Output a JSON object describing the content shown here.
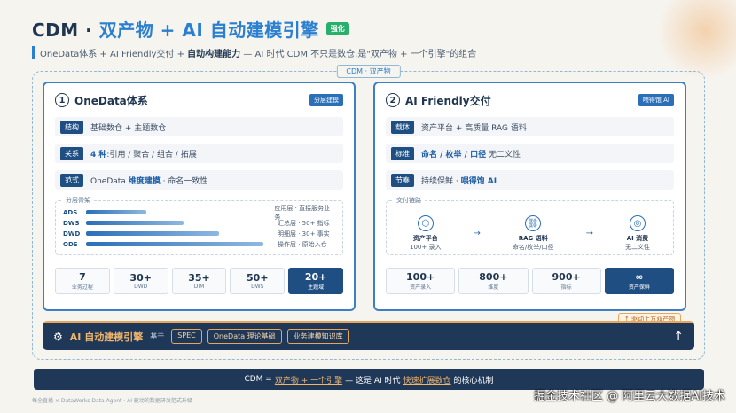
{
  "header": {
    "title_main": "CDM · ",
    "title_accent": "双产物 + AI 自动建模引擎",
    "badge": "强化",
    "subtitle_pre": "OneData体系 + AI Friendly交付 + ",
    "subtitle_bold": "自动构建能力",
    "subtitle_post": " — AI 时代 CDM 不只是数仓,是\"双产物 + 一个引擎\"的组合"
  },
  "frame_tag": "CDM · 双产物",
  "left_panel": {
    "num": "1",
    "title": "OneData体系",
    "tag": "分层建模",
    "rows": [
      {
        "label": "结构",
        "text": "基础数仓 + 主题数仓",
        "hi": "",
        "post": ""
      },
      {
        "label": "关系",
        "text": "",
        "hi": "4 种",
        "post": ":引用 / 聚合 / 组合 / 拓展"
      },
      {
        "label": "范式",
        "text": "OneData ",
        "hi": "维度建模",
        "post": " · 命名一致性"
      }
    ],
    "layers_title": "分层骨架",
    "layers": [
      {
        "code": "ADS",
        "fill": 0.35,
        "desc": "应用层 · 直接服务业务"
      },
      {
        "code": "DWS",
        "fill": 0.55,
        "desc": "汇总层 · 50+ 指标"
      },
      {
        "code": "DWD",
        "fill": 0.75,
        "desc": "明细层 · 30+ 事实"
      },
      {
        "code": "ODS",
        "fill": 1.0,
        "desc": "操作层 · 原始入仓"
      }
    ],
    "stats": [
      {
        "v": "7",
        "l": "业务过程"
      },
      {
        "v": "30+",
        "l": "DWD"
      },
      {
        "v": "35+",
        "l": "DIM"
      },
      {
        "v": "50+",
        "l": "DWS"
      },
      {
        "v": "20+",
        "l": "主题域"
      }
    ]
  },
  "right_panel": {
    "num": "2",
    "title": "AI Friendly交付",
    "tag": "喂得饱 AI",
    "rows": [
      {
        "label": "载体",
        "text": "资产平台 + 高质量 RAG 语料",
        "hi": "",
        "post": ""
      },
      {
        "label": "标准",
        "text": "",
        "hi": "命名 / 枚举 / 口径",
        "post": "  无二义性"
      },
      {
        "label": "节奏",
        "text": "持续保鲜 · ",
        "hi": "喂得饱 AI",
        "post": ""
      }
    ],
    "flow_title": "交付链路",
    "flow": [
      {
        "icon": "⬡",
        "name": "资产平台",
        "sub": "100+ 录入"
      },
      {
        "icon": "⛓",
        "name": "RAG 语料",
        "sub": "命名/枚举/口径"
      },
      {
        "icon": "◎",
        "name": "AI 消费",
        "sub": "无二义性"
      }
    ],
    "arrow": "→",
    "stats": [
      {
        "v": "100+",
        "l": "资产录入"
      },
      {
        "v": "800+",
        "l": "维度"
      },
      {
        "v": "900+",
        "l": "指标"
      },
      {
        "v": "∞",
        "l": "资产保鲜"
      }
    ]
  },
  "engine": {
    "gear": "⚙",
    "title": "AI 自动建模引擎",
    "base": "基于",
    "pills": [
      "SPEC",
      "OneData 理论基础",
      "业务建模知识库"
    ],
    "up": "↑",
    "drive_tag": "↑ 驱动上方双产物"
  },
  "formula": {
    "pre": "CDM = ",
    "a": "双产物 + 一个引擎",
    "mid": " — 这是 AI 时代 ",
    "b": "快速扩展数仓",
    "post": " 的核心机制"
  },
  "footer": "每全直播 × DataWorks Data Agent · AI 驱动的数据研发范式升级",
  "watermark": "掘金技术社区 @ 阿里云大数据AI技术"
}
